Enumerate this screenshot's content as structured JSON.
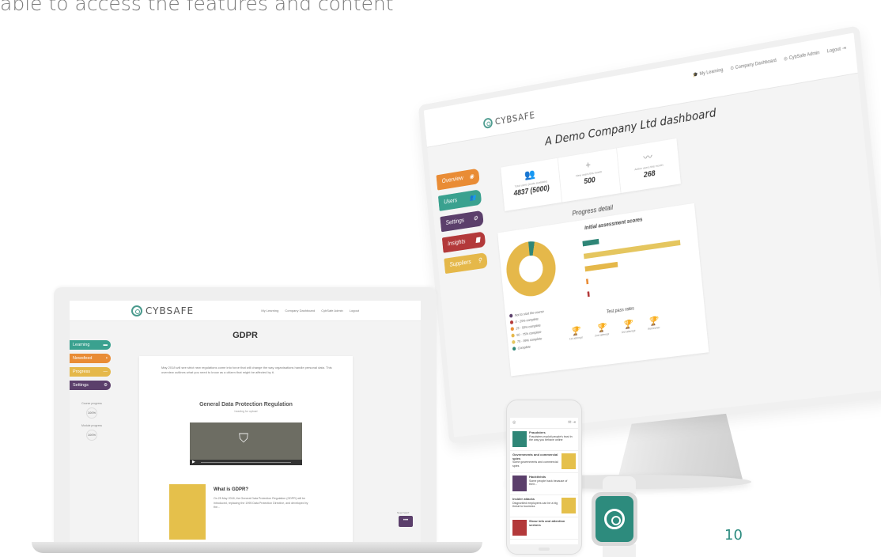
{
  "caption": "able to access the features and content",
  "page_number": "10",
  "colors": {
    "teal": "#2f8677",
    "green": "#3aa18f",
    "purple": "#5b3f6b",
    "red": "#b3393a",
    "orange": "#e98c35",
    "yellow": "#e5b84a"
  },
  "monitor": {
    "logo_text": "CYBSAFE",
    "nav": [
      "My Learning",
      "Company Dashboard",
      "CybSafe Admin",
      "Logout"
    ],
    "title": "A Demo Company Ltd dashboard",
    "sidebar": [
      {
        "label": "Overview",
        "color": "#e98c35"
      },
      {
        "label": "Users",
        "color": "#3aa18f"
      },
      {
        "label": "Settings",
        "color": "#5b3f6b"
      },
      {
        "label": "Insights",
        "color": "#b3393a"
      },
      {
        "label": "Suppliers",
        "color": "#e5b84a"
      }
    ],
    "stats": [
      {
        "icon": "users-icon",
        "label": "Total users (seats available)",
        "value": "4837 (5000)"
      },
      {
        "icon": "add-user-icon",
        "label": "New users this month",
        "value": "500"
      },
      {
        "icon": "activity-icon",
        "label": "Active users this month",
        "value": "268"
      }
    ],
    "progress_title": "Progress detail",
    "assessment_title": "Initial assessment scores",
    "legend": [
      {
        "label": "Not to start the course",
        "color": "#5b3f6b"
      },
      {
        "label": "0 - 25% complete",
        "color": "#b3393a"
      },
      {
        "label": "25 - 50% complete",
        "color": "#e98c35"
      },
      {
        "label": "50 - 75% complete",
        "color": "#e5b84a"
      },
      {
        "label": "75 - 99% complete",
        "color": "#e5c65f"
      },
      {
        "label": "Complete",
        "color": "#2f8677"
      }
    ],
    "test_pass_title": "Test pass rates",
    "test_pass": [
      {
        "label": "1st attempt"
      },
      {
        "label": "2nd attempt"
      },
      {
        "label": "3rd attempt"
      },
      {
        "label": "Refresher"
      }
    ]
  },
  "laptop": {
    "logo_text": "CYBSAFE",
    "nav": [
      "My Learning",
      "Company Dashboard",
      "CybSafe Admin",
      "Logout"
    ],
    "title": "GDPR",
    "sidebar": [
      {
        "label": "Learning",
        "color": "#3aa18f"
      },
      {
        "label": "Newsfeed",
        "color": "#e98c35"
      },
      {
        "label": "Progress",
        "color": "#e5b84a"
      },
      {
        "label": "Settings",
        "color": "#5b3f6b"
      }
    ],
    "course_progress_label": "Course progress",
    "course_progress_value": "100%",
    "module_progress_label": "Module progress",
    "module_progress_value": "100%",
    "intro": "May 2018 will see strict new regulations come into force that will change the way organisations handle personal data. This overview outlines what you need to know as a citizen that might be affected by it.",
    "video_title": "General Data Protection Regulation",
    "video_subtitle": "heading for upload",
    "card_title": "What is GDPR?",
    "card_text": "On 25 May 2018, the General Data Protection Regulation (GDPR) will be introduced, replacing the 1995 Data Protection Directive, and developed by the...",
    "chat_label": "Need help?"
  },
  "phone": {
    "items": [
      {
        "title": "Fraudsters",
        "text": "Fraudsters exploit people's trust in the way you behave online",
        "color": "#2f8677"
      },
      {
        "title": "Governments and commercial spies",
        "text": "Some governments and commercial spies",
        "color": "#e5c04b"
      },
      {
        "title": "Hacktivists",
        "text": "Some people hack because of their...",
        "color": "#5b3f6b"
      },
      {
        "title": "Insider attacks",
        "text": "Disgruntled employees can be a big threat to business",
        "color": "#e5c04b"
      },
      {
        "title": "Show info and attention seekers",
        "text": "",
        "color": "#b3393a"
      }
    ]
  }
}
